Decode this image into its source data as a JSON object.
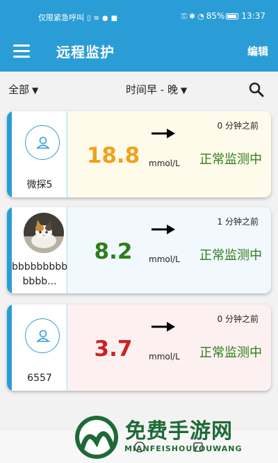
{
  "status_bar": {
    "carrier": "仅限紧急呼叫",
    "battery": "85%",
    "time": "13:37"
  },
  "app_bar": {
    "title": "远程监护",
    "edit_label": "编辑"
  },
  "filters": {
    "all_label": "全部",
    "time_label": "时间早 - 晚"
  },
  "patients": [
    {
      "name": "微探5",
      "reading": "18.8",
      "unit": "mmol/L",
      "time_ago": "0 分钟之前",
      "status": "正常监测中",
      "reading_color": "#f0a21c",
      "card_tint": "#fffbea",
      "trend": "flat"
    },
    {
      "name": "bbbbbbbbbbbbb...",
      "reading": "8.2",
      "unit": "mmol/L",
      "time_ago": "1 分钟之前",
      "status": "正常监测中",
      "reading_color": "#2e7d1a",
      "card_tint": "#f1f8fe",
      "trend": "flat"
    },
    {
      "name": "6557",
      "reading": "3.7",
      "unit": "mmol/L",
      "time_ago": "0 分钟之前",
      "status": "正常监测中",
      "reading_color": "#cc2222",
      "card_tint": "#fdf0f0",
      "trend": "flat"
    }
  ],
  "watermark": {
    "title": "免费手游网",
    "subtitle": "MIANFEISHOUYOUWANG"
  },
  "colors": {
    "primary": "#2b9dd6",
    "status_green": "#2e7d1a"
  }
}
